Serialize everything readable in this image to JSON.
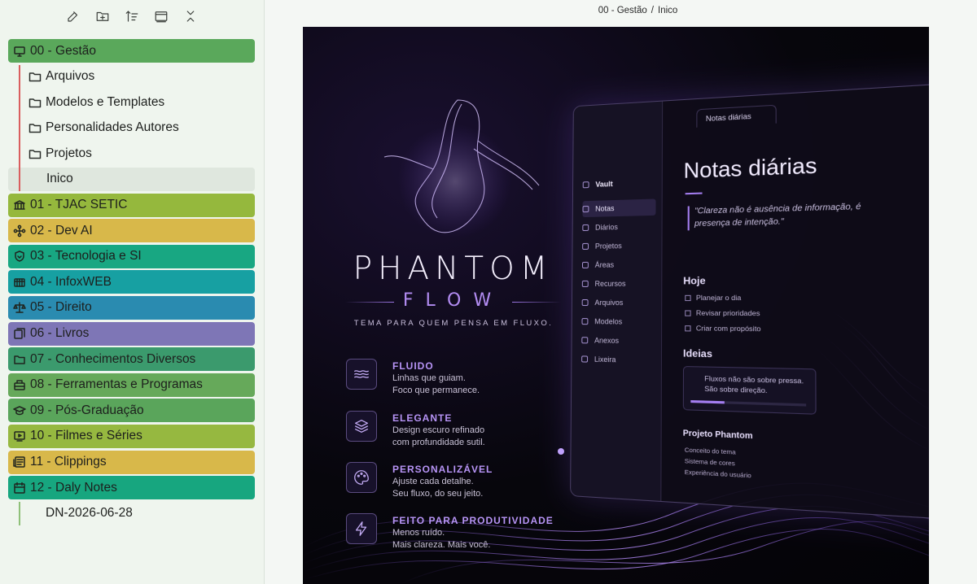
{
  "sidebar": {
    "toolbar": [
      {
        "name": "new-note-button",
        "icon": "edit-icon"
      },
      {
        "name": "new-folder-button",
        "icon": "folder-plus-icon"
      },
      {
        "name": "sort-button",
        "icon": "sort-icon"
      },
      {
        "name": "auto-reveal-button",
        "icon": "reveal-icon"
      },
      {
        "name": "collapse-all-button",
        "icon": "collapse-icon"
      }
    ],
    "folders": [
      {
        "label": "00 - Gestão",
        "color": "#5aa85b",
        "icon": "monitor-icon",
        "rail_color": "#d95e5e",
        "children": [
          {
            "label": "Arquivos",
            "type": "folder"
          },
          {
            "label": "Modelos e Templates",
            "type": "folder"
          },
          {
            "label": "Personalidades Autores",
            "type": "folder"
          },
          {
            "label": "Projetos",
            "type": "folder"
          },
          {
            "label": "Inico",
            "type": "note",
            "active": true
          }
        ]
      },
      {
        "label": "01 - TJAC SETIC",
        "color": "#95b83d",
        "icon": "bank-icon"
      },
      {
        "label": "02 -  Dev AI",
        "color": "#d8b84a",
        "icon": "network-icon"
      },
      {
        "label": "03 - Tecnologia e SI",
        "color": "#18a782",
        "icon": "shield-icon"
      },
      {
        "label": "04 - InfoxWEB",
        "color": "#17a0a2",
        "icon": "globe-icon"
      },
      {
        "label": "05 - Direito",
        "color": "#2a8bb0",
        "icon": "scale-icon"
      },
      {
        "label": "06 - Livros",
        "color": "#7e76b6",
        "icon": "books-icon"
      },
      {
        "label": "07 - Conhecimentos Diversos",
        "color": "#3b9a6d",
        "icon": "folder-icon"
      },
      {
        "label": "08 - Ferramentas e Programas",
        "color": "#66a95a",
        "icon": "toolbox-icon"
      },
      {
        "label": "09 -  Pós-Graduação",
        "color": "#5aa55b",
        "icon": "graduation-icon"
      },
      {
        "label": "10 -  Filmes e Séries",
        "color": "#96b840",
        "icon": "tv-icon"
      },
      {
        "label": "11 - Clippings",
        "color": "#d8b84a",
        "icon": "newspaper-icon"
      },
      {
        "label": "12 - Daly Notes",
        "color": "#17a67f",
        "icon": "calendar-icon",
        "rail_color": "#8fc079",
        "children": [
          {
            "label": "DN-2026-06-28",
            "type": "note",
            "active": false
          }
        ]
      }
    ]
  },
  "breadcrumb": {
    "parent": "00 - Gestão",
    "separator": "/",
    "current": "Inico"
  },
  "artwork": {
    "title": "PHANTOM",
    "subtitle": "FLOW",
    "tagline": "TEMA PARA QUEM PENSA EM FLUXO.",
    "features": [
      {
        "title": "FLUIDO",
        "lines": [
          "Linhas que guiam.",
          "Foco que permanece."
        ],
        "icon": "waves-icon"
      },
      {
        "title": "ELEGANTE",
        "lines": [
          "Design escuro refinado",
          "com profundidade sutil."
        ],
        "icon": "layers-icon"
      },
      {
        "title": "PERSONALIZÁVEL",
        "lines": [
          "Ajuste cada detalhe.",
          "Seu fluxo, do seu jeito."
        ],
        "icon": "palette-icon"
      },
      {
        "title": "FEITO PARA PRODUTIVIDADE",
        "lines": [
          "Menos ruído.",
          "Mais clareza. Mais você."
        ],
        "icon": "lightning-icon"
      }
    ],
    "mockup": {
      "vault": "Vault",
      "tab": "Notas diárias",
      "nav": [
        "Notas",
        "Diários",
        "Projetos",
        "Áreas",
        "Recursos",
        "Arquivos",
        "Modelos",
        "Anexos",
        "Lixeira"
      ],
      "heading": "Notas diárias",
      "quote": "\"Clareza não é ausência de informação, é presença de intenção.\"",
      "today_heading": "Hoje",
      "today_items": [
        "Planejar o dia",
        "Revisar prioridades",
        "Criar com propósito"
      ],
      "ideas_heading": "Ideias",
      "idea_card": [
        "Fluxos não são sobre pressa.",
        "São sobre direção."
      ],
      "project_heading": "Projeto Phantom",
      "project_items": [
        "Conceito do tema",
        "Sistema de cores",
        "Experiência do usuário"
      ]
    }
  }
}
